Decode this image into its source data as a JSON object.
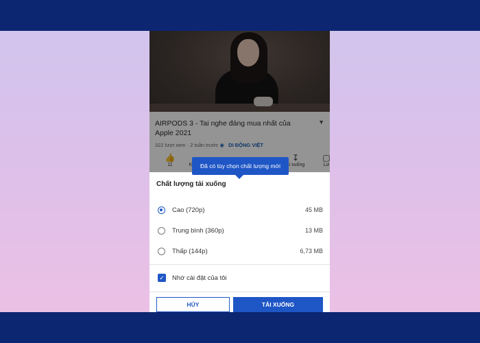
{
  "video": {
    "title": "AIRPODS 3 - Tai nghe đáng mua nhất của Apple 2021",
    "views": "322 lượt xem · 2 tuần trước",
    "channel": "DI ĐỘNG VIỆT",
    "like_count": "11",
    "action_k": "K",
    "action_download": "ải xuống",
    "action_lu": "Lư"
  },
  "tooltip": {
    "text": "Đã có tùy chọn chất lượng mới"
  },
  "sheet": {
    "title": "Chất lượng tải xuống",
    "options": [
      {
        "label": "Cao (720p)",
        "size": "45 MB",
        "selected": true
      },
      {
        "label": "Trung bình (360p)",
        "size": "13 MB",
        "selected": false
      },
      {
        "label": "Thấp (144p)",
        "size": "6,73 MB",
        "selected": false
      }
    ],
    "remember_label": "Nhớ cài đặt của tôi",
    "remember_checked": true,
    "cancel_label": "HỦY",
    "download_label": "TẢI XUỐNG"
  },
  "colors": {
    "accent": "#1f56c6",
    "band": "#0c2672"
  }
}
